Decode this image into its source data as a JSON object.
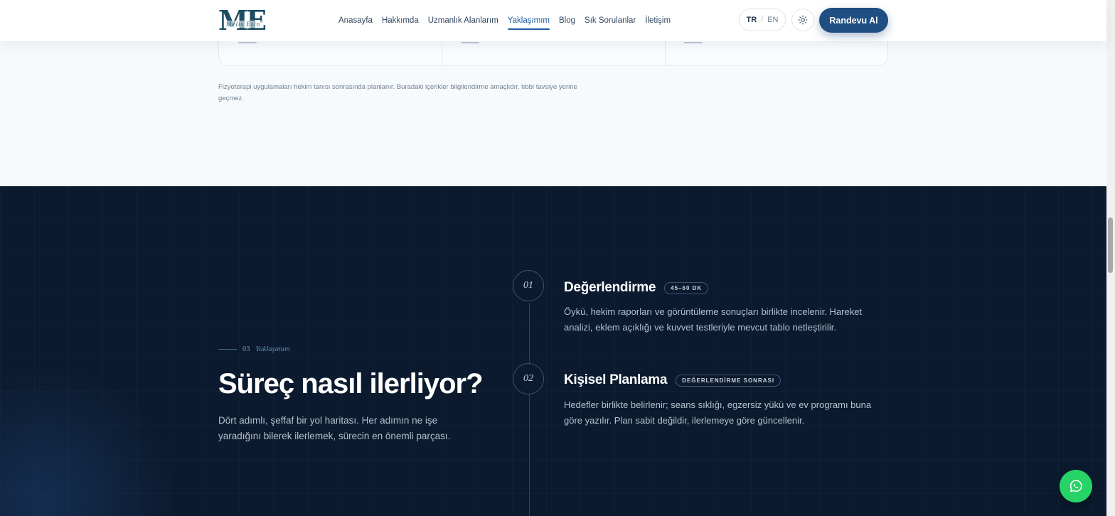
{
  "header": {
    "logo_letters": "ME",
    "logo_script": "Melis Esin",
    "nav": [
      {
        "label": "Anasayfa",
        "active": false
      },
      {
        "label": "Hakkımda",
        "active": false
      },
      {
        "label": "Uzmanlık Alanlarım",
        "active": false
      },
      {
        "label": "Yaklaşımım",
        "active": true
      },
      {
        "label": "Blog",
        "active": false
      },
      {
        "label": "Sık Sorulanlar",
        "active": false
      },
      {
        "label": "İletişim",
        "active": false
      }
    ],
    "lang_active": "TR",
    "lang_separator": "/",
    "lang_other": "EN",
    "theme_icon": "sun-icon",
    "cta_label": "Randevu Al"
  },
  "intro": {
    "disclaimer": "Fizyoterapi uygulamaları hekim tanısı sonrasında planlanır. Buradaki içerikler bilgilendirme amaçlıdır, tıbbi tavsiye yerine geçmez."
  },
  "approach": {
    "eyebrow_number": "03",
    "eyebrow_label": "Yaklaşımım",
    "title": "Süreç nasıl ilerliyor?",
    "subtitle": "Dört adımlı, şeffaf bir yol haritası. Her adımın ne işe yaradığını bilerek ilerlemek, sürecin en önemli parçası.",
    "steps": [
      {
        "number": "01",
        "title": "Değerlendirme",
        "badge": "45–60 DK",
        "description": "Öykü, hekim raporları ve görüntüleme sonuçları birlikte incelenir. Hareket analizi, eklem açıklığı ve kuvvet testleriyle mevcut tablo netleştirilir."
      },
      {
        "number": "02",
        "title": "Kişisel Planlama",
        "badge": "DEĞERLENDİRME SONRASI",
        "description": "Hedefler birlikte belirlenir; seans sıklığı, egzersiz yükü ve ev programı buna göre yazılır. Plan sabit değildir, ilerlemeye göre güncellenir."
      }
    ]
  },
  "colors": {
    "brand": "#1f4e82",
    "dark_bg": "#0b1a2e",
    "whatsapp": "#25d366"
  },
  "floating": {
    "whatsapp_icon": "whatsapp-icon"
  }
}
